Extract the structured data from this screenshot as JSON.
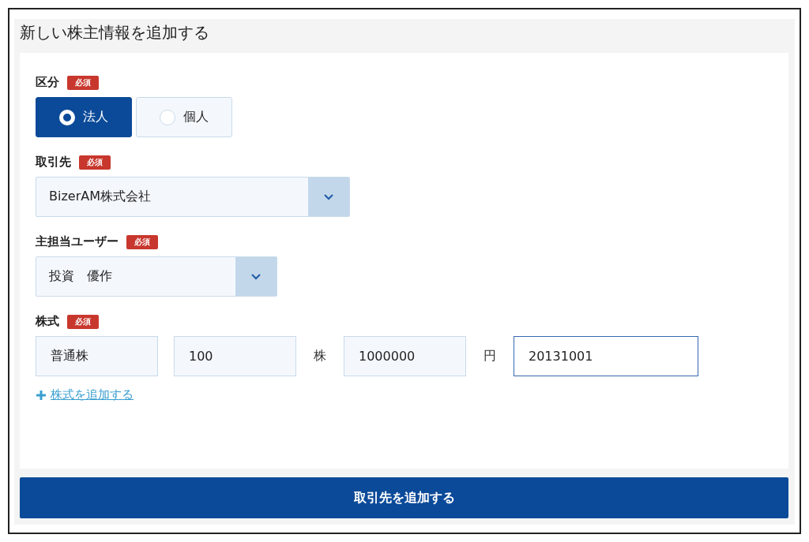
{
  "panel": {
    "title": "新しい株主情報を追加する"
  },
  "sections": [
    {
      "kind": "radio",
      "label": "区分",
      "required_badge": "必須",
      "options": [
        {
          "label": "法人",
          "selected": true
        },
        {
          "label": "個人",
          "selected": false
        }
      ]
    },
    {
      "kind": "select",
      "label": "取引先",
      "required_badge": "必須",
      "value": "BizerAM株式会社"
    },
    {
      "kind": "select",
      "label": "主担当ユーザー",
      "required_badge": "必須",
      "value": "投資　優作"
    },
    {
      "kind": "shares",
      "label": "株式",
      "required_badge": "必須",
      "items": [
        {
          "kind": "field",
          "value": "普通株",
          "focused": false
        },
        {
          "kind": "field",
          "value": "100",
          "focused": false
        },
        {
          "kind": "unit",
          "text": "株"
        },
        {
          "kind": "field",
          "value": "1000000",
          "focused": false
        },
        {
          "kind": "unit",
          "text": "円"
        },
        {
          "kind": "field",
          "value": "20131001",
          "focused": true
        }
      ],
      "add_link": "株式を追加する"
    }
  ],
  "submit_button": "取引先を追加する"
}
